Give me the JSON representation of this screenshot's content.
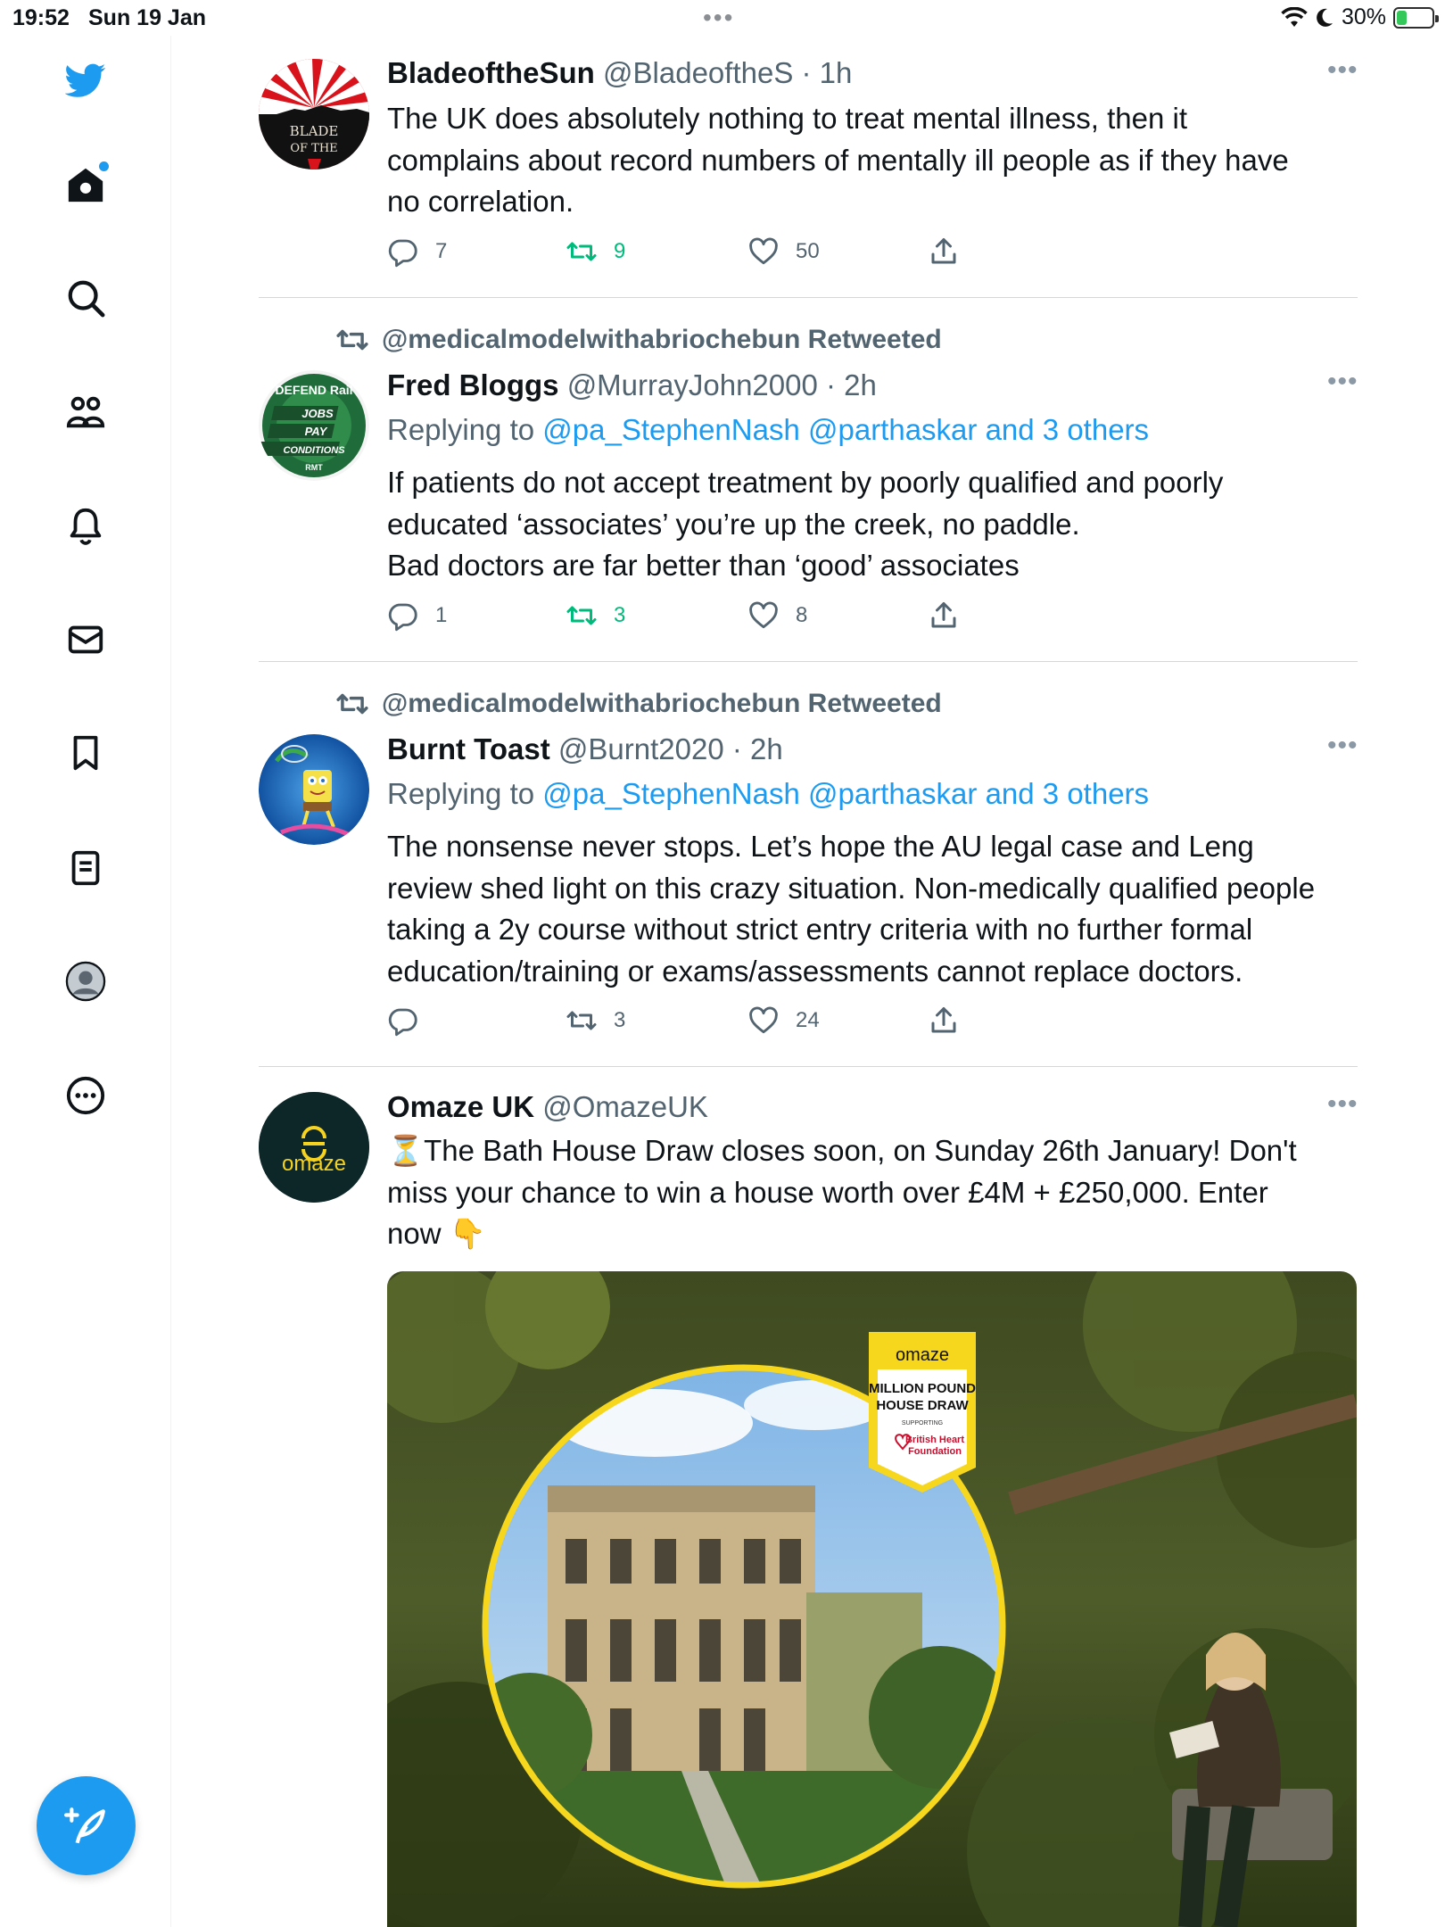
{
  "status_bar": {
    "time": "19:52",
    "date": "Sun 19 Jan",
    "battery": "30%"
  },
  "sidebar": {
    "items": [
      {
        "name": "twitter-logo"
      },
      {
        "name": "home"
      },
      {
        "name": "search"
      },
      {
        "name": "communities"
      },
      {
        "name": "notifications"
      },
      {
        "name": "messages"
      },
      {
        "name": "bookmarks"
      },
      {
        "name": "lists"
      },
      {
        "name": "profile"
      },
      {
        "name": "more"
      }
    ]
  },
  "tweets": [
    {
      "name": "BladeoftheSun",
      "handle": "@BladeoftheS",
      "time": "· 1h",
      "text_lines": [
        "The UK does absolutely nothing to treat mental illness, then it",
        "complains about record numbers of mentally ill people as if they have",
        "no correlation."
      ],
      "replies": "7",
      "retweets": "9",
      "likes": "50",
      "avatar_text": "BLADE OF THE"
    },
    {
      "retweeted_by": "@medicalmodelwithabriochebun Retweeted",
      "name": "Fred Bloggs",
      "handle": "@MurrayJohn2000",
      "time": "· 2h",
      "replying_label": "Replying to",
      "replying_links": "@pa_StephenNash @parthaskar and 3 others",
      "text_lines": [
        "If patients do not accept treatment by poorly qualified and poorly",
        "educated ‘associates’ you’re up the creek, no paddle.",
        "Bad doctors are far better than ‘good’ associates"
      ],
      "replies": "1",
      "retweets": "3",
      "likes": "8",
      "avatar_badge": {
        "top": "DEFEND Rail",
        "jobs": "JOBS",
        "pay": "PAY",
        "conditions": "CONDITIONS",
        "rmt": "RMT"
      }
    },
    {
      "retweeted_by": "@medicalmodelwithabriochebun Retweeted",
      "name": "Burnt Toast",
      "handle": "@Burnt2020",
      "time": "· 2h",
      "replying_label": "Replying to",
      "replying_links": "@pa_StephenNash @parthaskar and 3 others",
      "text_lines": [
        "The nonsense never stops. Let’s hope the AU legal case and Leng",
        "review shed light on this crazy situation. Non-medically qualified people",
        "taking a 2y course without strict entry criteria with no further formal",
        "education/training or exams/assessments cannot replace doctors."
      ],
      "replies": "",
      "retweets": "3",
      "likes": "24"
    },
    {
      "name": "Omaze UK",
      "handle": "@OmazeUK",
      "time": "",
      "text_lines": [
        "⏳The Bath House Draw closes soon, on Sunday 26th January! Don't",
        "miss your chance to win a house worth over £4M + £250,000. Enter",
        "now 👇"
      ],
      "avatar_text": "omaze",
      "media_badge": {
        "brand": "omaze",
        "title_1": "MILLION POUND",
        "title_2": "HOUSE DRAW",
        "supporting": "SUPPORTING",
        "charity_1": "British Heart",
        "charity_2": "Foundation"
      }
    }
  ],
  "colors": {
    "accent": "#1d9bf0",
    "retweet_green": "#00ba7c",
    "muted": "#536471"
  }
}
